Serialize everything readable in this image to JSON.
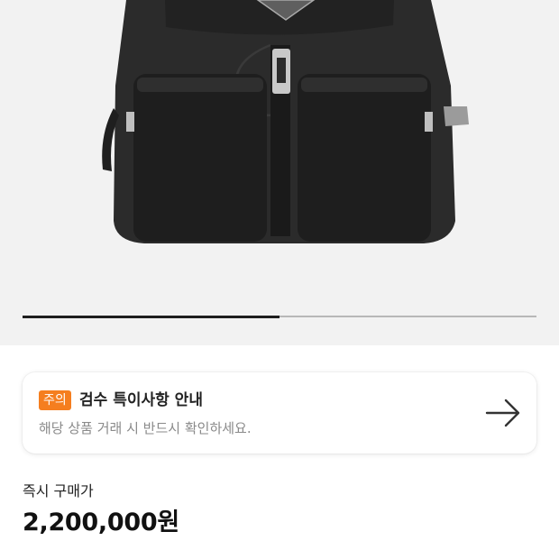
{
  "product_image": {
    "alt_icon": "backpack-image",
    "slide_progress": 0.5
  },
  "notice": {
    "badge": "주의",
    "title": "검수 특이사항 안내",
    "description": "해당 상품 거래 시 반드시 확인하세요.",
    "icon": "arrow-right-icon",
    "badge_color": "#f57e1f"
  },
  "price": {
    "label": "즉시 구매가",
    "value": "2,200,000원"
  }
}
